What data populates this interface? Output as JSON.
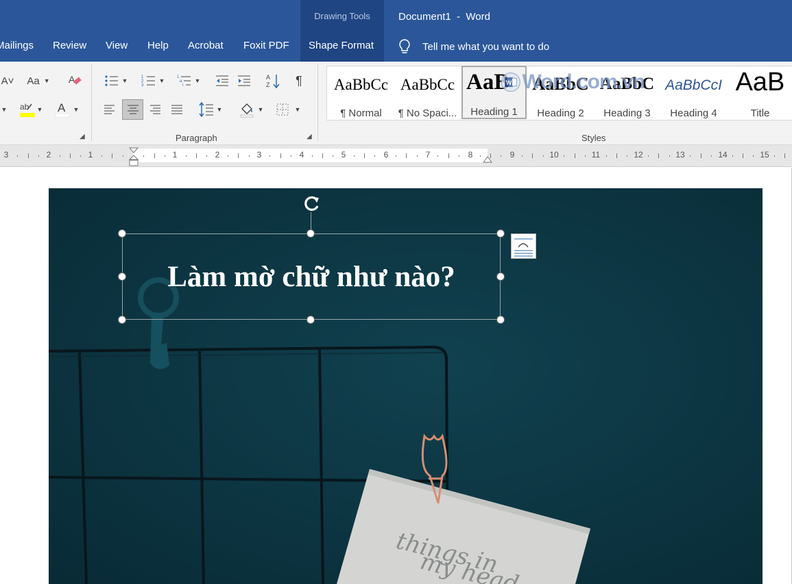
{
  "titlebar": {
    "contextual_group": "Drawing Tools",
    "document_title": "Document1  -  Word"
  },
  "tabs": [
    {
      "label": "Mailings"
    },
    {
      "label": "Review"
    },
    {
      "label": "View"
    },
    {
      "label": "Help"
    },
    {
      "label": "Acrobat"
    },
    {
      "label": "Foxit PDF"
    },
    {
      "label": "Shape Format",
      "selected": true
    }
  ],
  "tell_me": {
    "text": "Tell me what you want to do",
    "icon": "lightbulb-icon"
  },
  "ribbon": {
    "font_group": {
      "buttons": [
        {
          "name": "shrink-font",
          "glyph": "A˅"
        },
        {
          "name": "change-case",
          "glyph": "Aa"
        },
        {
          "name": "clear-formatting",
          "icon": "eraser-icon"
        },
        {
          "name": "text-highlight",
          "glyph": "ab",
          "color": "#ffff00"
        },
        {
          "name": "font-color",
          "glyph": "A",
          "color": "#ffffff"
        }
      ]
    },
    "paragraph_group": {
      "label": "Paragraph",
      "selected_alignment": "center",
      "buttons": [
        "bullets",
        "numbering",
        "multilevel-list",
        "decrease-indent",
        "increase-indent",
        "sort",
        "show-marks",
        "align-left",
        "align-center",
        "align-right",
        "justify",
        "line-spacing",
        "shading",
        "borders"
      ]
    },
    "styles_group": {
      "label": "Styles",
      "items": [
        {
          "preview": "AaBbCc",
          "name": "¶ Normal"
        },
        {
          "preview": "AaBbCc",
          "name": "¶ No Spaci..."
        },
        {
          "preview": "AaB",
          "name": "Heading 1",
          "selected": true
        },
        {
          "preview": "AaBbC",
          "name": "Heading 2"
        },
        {
          "preview": "AaBbC",
          "name": "Heading 3"
        },
        {
          "preview": "AaBbCcI",
          "name": "Heading 4"
        },
        {
          "preview": "AaB",
          "name": "Title"
        }
      ]
    }
  },
  "watermark": {
    "text": "Word.com.vn",
    "icon": "word-logo-icon"
  },
  "ruler": {
    "left_numbers": [
      "3",
      "2",
      "1"
    ],
    "right_numbers": [
      "1",
      "2",
      "3",
      "4",
      "5",
      "6",
      "7",
      "8",
      "9",
      "10",
      "11",
      "12",
      "13",
      "14",
      "15"
    ]
  },
  "document": {
    "textbox_text": "Làm mờ chữ như nào?",
    "note_text": [
      "things in",
      "my head"
    ],
    "photo_color": "#0b3340"
  },
  "colors": {
    "ribbon_blue": "#2b579a",
    "context_tab": "#1f4583"
  }
}
